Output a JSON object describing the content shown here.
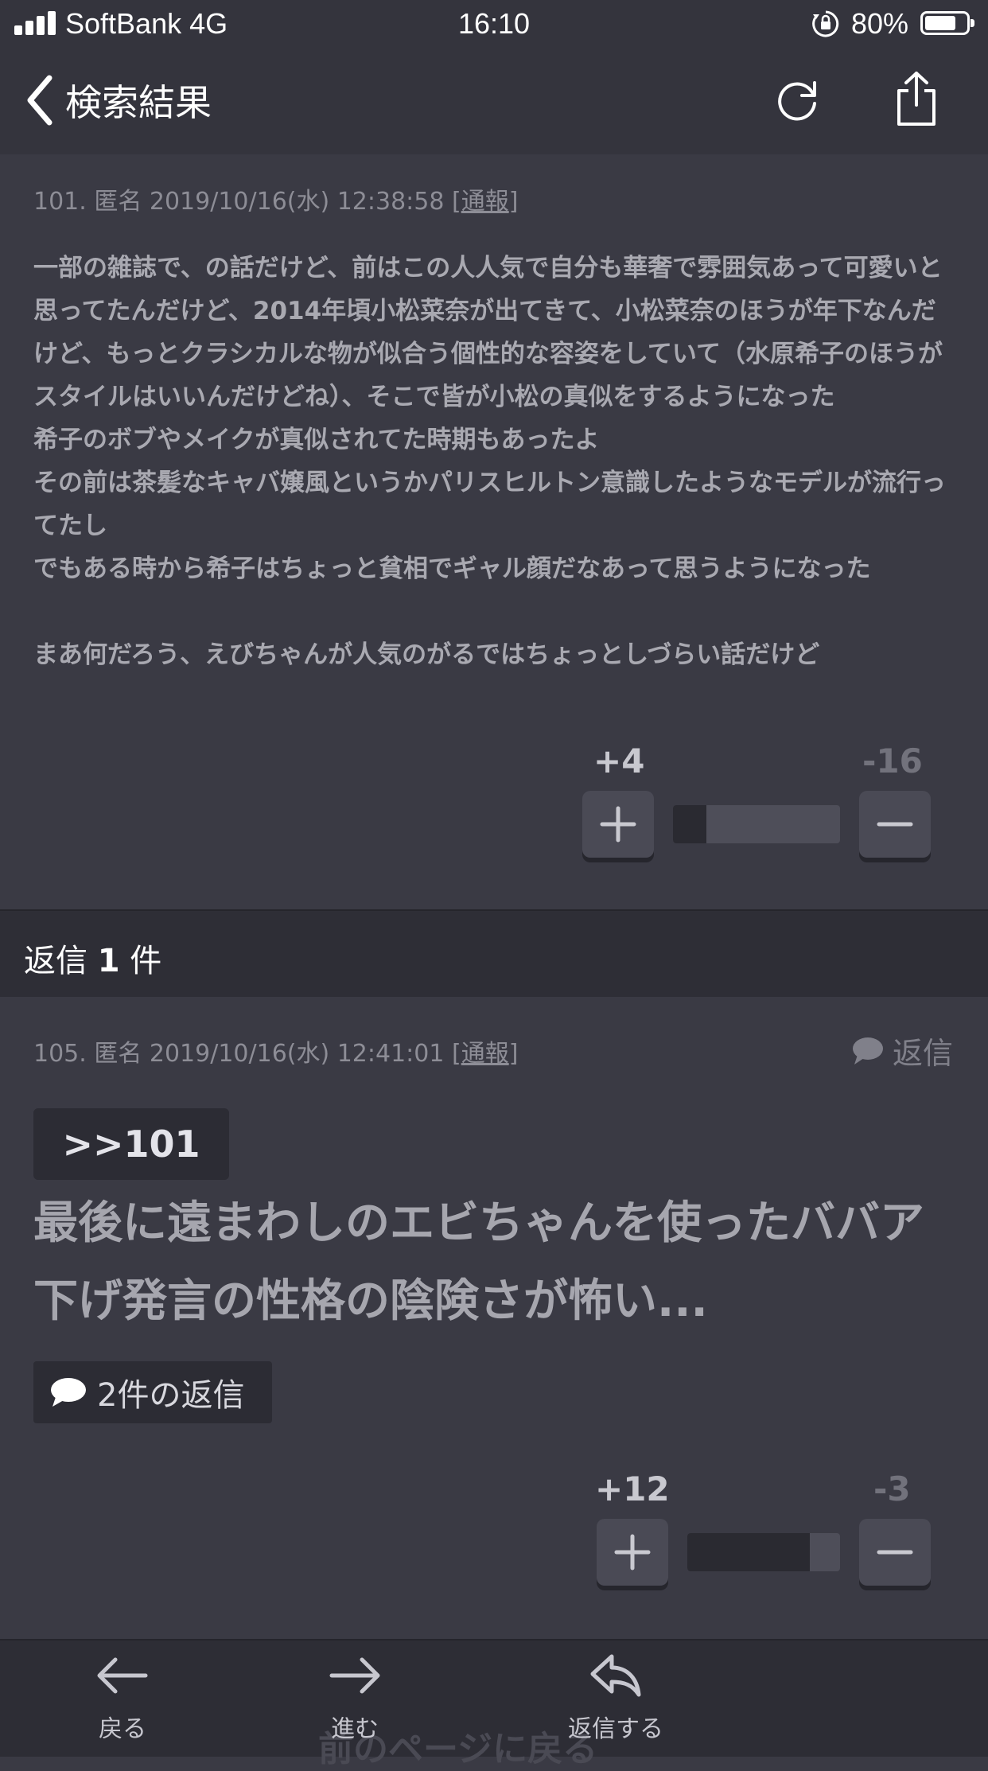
{
  "status_bar": {
    "carrier": "SoftBank 4G",
    "time": "16:10",
    "battery_percent": "80%",
    "battery_level": 0.8
  },
  "nav": {
    "back_label": "検索結果"
  },
  "post_101": {
    "meta": "101. 匿名 2019/10/16(水) 12:38:58 [",
    "report": "通報",
    "meta_end": "]",
    "body": "一部の雑誌で、の話だけど、前はこの人人気で自分も華奢で雰囲気あって可愛いと思ってたんだけど、2014年頃小松菜奈が出てきて、小松菜奈のほうが年下なんだけど、もっとクラシカルな物が似合う個性的な容姿をしていて（水原希子のほうがスタイルはいいんだけどね）、そこで皆が小松の真似をするようになった\n希子のボブやメイクが真似されてた時期もあったよ\nその前は茶髪なキャバ嬢風というかパリスヒルトン意識したようなモデルが流行ってたし\nでもある時から希子はちょっと貧相でギャル顔だなあって思うようになった\n\nまあ何だろう、えびちゃんが人気のがるではちょっとしづらい話だけど",
    "plus": "+4",
    "minus": "-16",
    "plus_share": 0.2
  },
  "replies_header": {
    "prefix": "返信 ",
    "count": "1",
    "suffix": " 件"
  },
  "post_105": {
    "meta": "105. 匿名 2019/10/16(水) 12:41:01 [",
    "report": "通報",
    "meta_end": "]",
    "reply_label": "返信",
    "anchor": ">>101",
    "headline": "最後に遠まわしのエビちゃんを使ったババア下げ発言の性格の陰険さが怖い...",
    "replies_button": "2件の返信",
    "plus": "+12",
    "minus": "-3",
    "plus_share": 0.8
  },
  "toolbar": {
    "back": "戻る",
    "forward": "進む",
    "reply": "返信する",
    "ghost": "前のページに戻る"
  }
}
